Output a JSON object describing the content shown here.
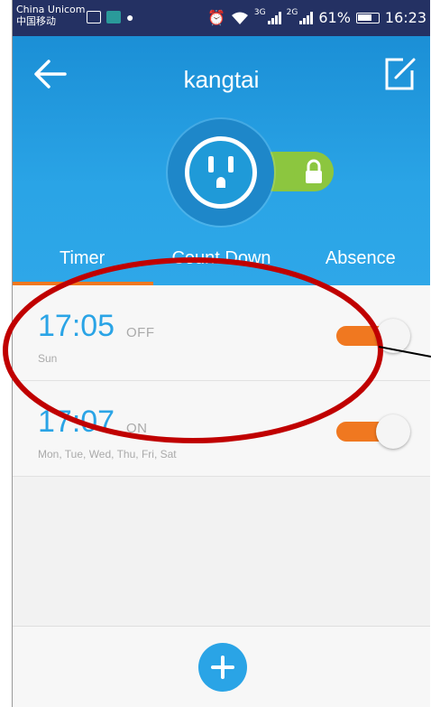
{
  "status_bar": {
    "carrier_line1": "China Unicom",
    "carrier_line2": "中国移动",
    "net1": "3G",
    "net2": "2G",
    "battery": "61%",
    "time": "16:23"
  },
  "header": {
    "title": "kangtai",
    "back_icon": "arrow-left-icon",
    "edit_icon": "edit-icon",
    "device_icon": "power-outlet-icon",
    "lock_icon": "lock-icon"
  },
  "tabs": [
    {
      "label": "Timer",
      "active": true
    },
    {
      "label": "Count Down",
      "active": false
    },
    {
      "label": "Absence",
      "active": false
    }
  ],
  "timers": [
    {
      "time": "17:05",
      "state": "OFF",
      "days": "Sun",
      "enabled": true
    },
    {
      "time": "17:07",
      "state": "ON",
      "days": "Mon, Tue, Wed, Thu, Fri, Sat",
      "enabled": true
    }
  ],
  "bottom": {
    "add_icon": "plus-icon"
  },
  "colors": {
    "status_bar": "#243163",
    "header": "#2aa4e6",
    "accent": "#f07820",
    "lock": "#8cc63f",
    "annotation": "#c00000"
  }
}
